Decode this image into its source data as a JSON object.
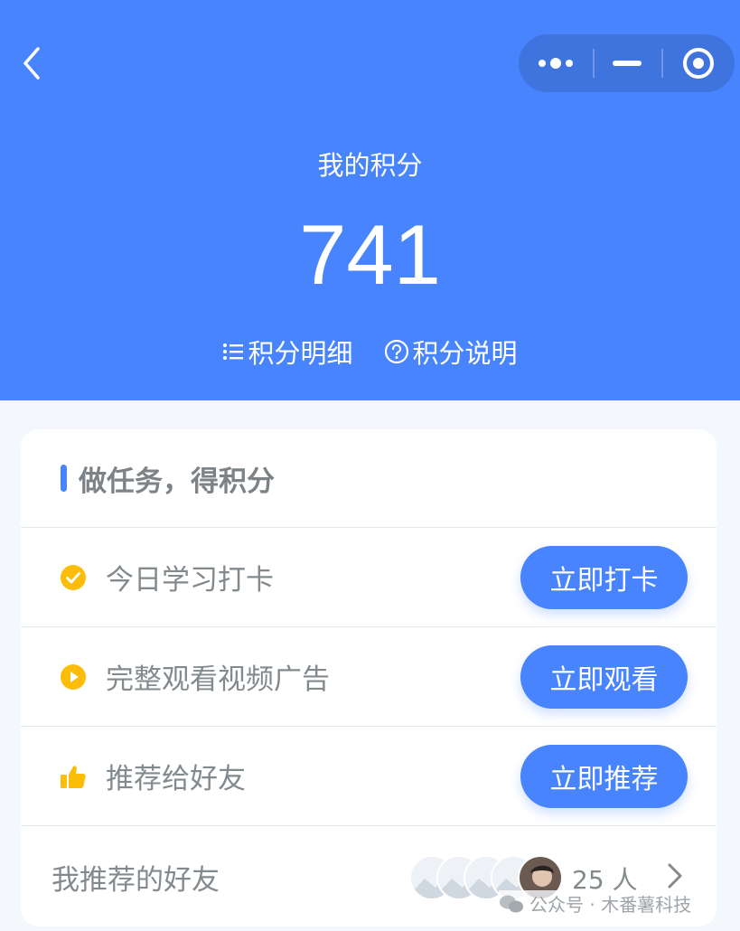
{
  "header": {
    "title": "我的积分",
    "points": "741",
    "detail_link": "积分明细",
    "explain_link": "积分说明"
  },
  "icons": {
    "back": "chevron-left-icon",
    "more": "more-dots-icon",
    "minimize": "minimize-icon",
    "close": "target-close-icon",
    "list": "list-icon",
    "help": "question-circle-icon",
    "checkin": "check-circle-icon",
    "video": "play-circle-icon",
    "recommend": "thumbs-up-icon",
    "arrow": "chevron-right-icon"
  },
  "card": {
    "title": "做任务，得积分",
    "tasks": [
      {
        "label": "今日学习打卡",
        "button": "立即打卡"
      },
      {
        "label": "完整观看视频广告",
        "button": "立即观看"
      },
      {
        "label": "推荐给好友",
        "button": "立即推荐"
      }
    ],
    "friends": {
      "label": "我推荐的好友",
      "count": "25 人"
    }
  },
  "watermark": "公众号 · 木番薯科技",
  "colors": {
    "primary": "#4784fd",
    "accent": "#fbbd08",
    "background": "#f4f7fb",
    "text_muted": "#838a8e"
  }
}
